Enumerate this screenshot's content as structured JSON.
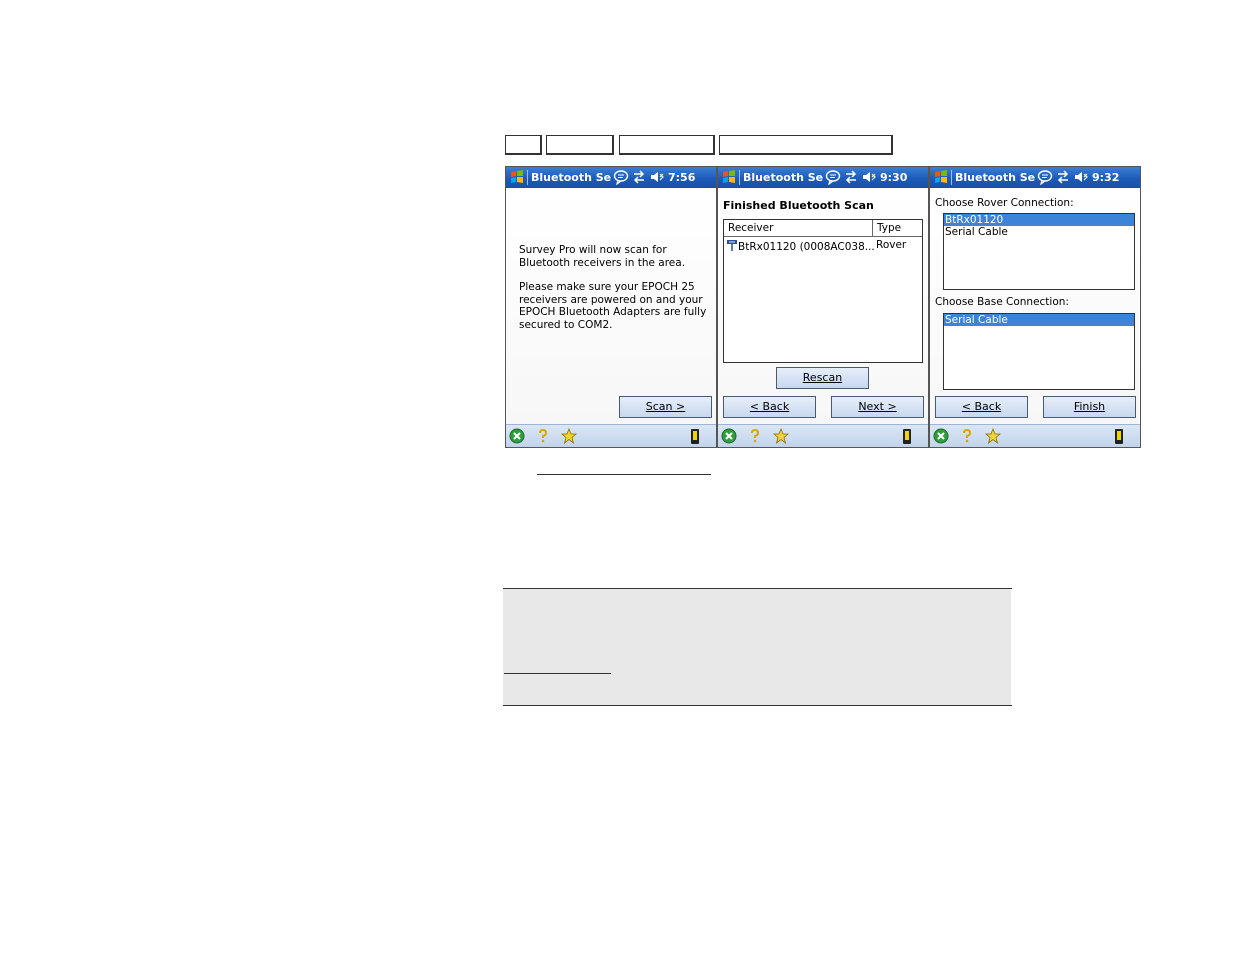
{
  "screens": [
    {
      "title": "Bluetooth Setu",
      "time": "7:56",
      "message_p1": "Survey Pro will now scan for Bluetooth receivers in the area.",
      "message_p2": "Please make sure your EPOCH 25 receivers are powered on and your EPOCH Bluetooth Adapters are fully secured to COM2.",
      "scan_button": "Scan >"
    },
    {
      "title": "Bluetooth Setu",
      "time": "9:30",
      "heading": "Finished Bluetooth Scan",
      "columns": [
        "Receiver",
        "Type"
      ],
      "rows": [
        {
          "receiver": "BtRx01120 (0008AC038...",
          "type": "Rover"
        }
      ],
      "rescan_button": "Rescan",
      "back_button": "< Back",
      "next_button": "Next >"
    },
    {
      "title": "Bluetooth Setu",
      "time": "9:32",
      "rover_label": "Choose Rover Connection:",
      "rover_options": [
        "BtRx01120",
        "Serial Cable"
      ],
      "rover_selected": "BtRx01120",
      "base_label": "Choose Base Connection:",
      "base_options": [
        "Serial Cable"
      ],
      "base_selected": "Serial Cable",
      "back_button": "< Back",
      "finish_button": "Finish"
    }
  ],
  "colors": {
    "titlebar": "#1c5bb8",
    "selection": "#3d84d9",
    "bottombar": "#c2d3ea",
    "note_bg": "#e8e8e8"
  },
  "icons": {
    "titlebar": [
      "windows-start-icon",
      "notification-icon",
      "connectivity-icon",
      "volume-icon"
    ],
    "bottombar": [
      "close-icon",
      "help-icon",
      "favorites-icon",
      "gps-receiver-icon"
    ]
  }
}
